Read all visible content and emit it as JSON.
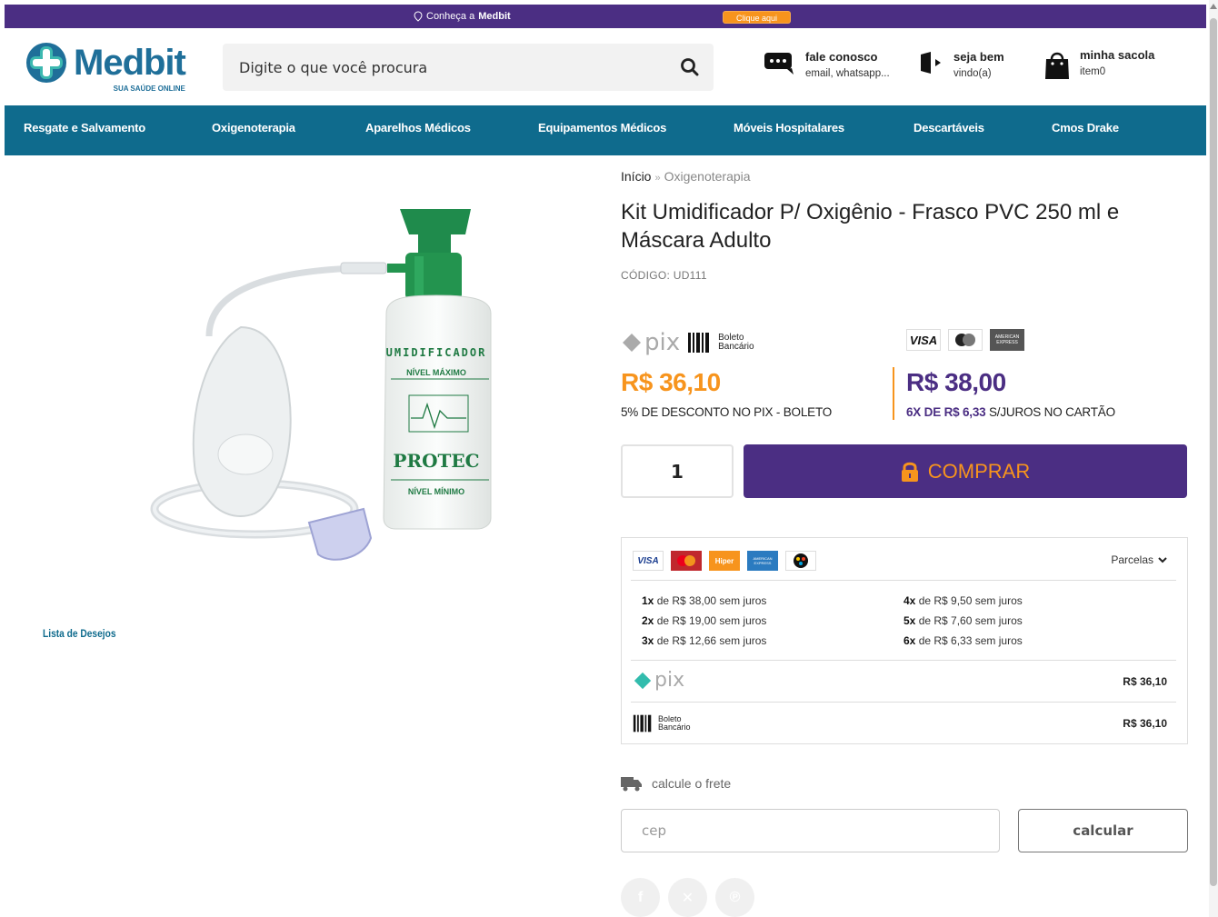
{
  "topbar": {
    "announce_prefix": "Conheça a",
    "announce_brand": "Medbit",
    "cta": "Clique aqui"
  },
  "header": {
    "logo_name": "Medbit",
    "logo_tagline": "SUA SAÚDE ONLINE",
    "search_placeholder": "Digite o que você procura",
    "contact": {
      "title": "fale conosco",
      "subtitle": "email, whatsapp..."
    },
    "account": {
      "title": "seja bem",
      "subtitle": "vindo(a)"
    },
    "bag": {
      "title": "minha sacola",
      "subtitle": "item0"
    }
  },
  "nav": [
    "Resgate e Salvamento",
    "Oxigenoterapia",
    "Aparelhos Médicos",
    "Equipamentos Médicos",
    "Móveis Hospitalares",
    "Descartáveis",
    "Cmos Drake"
  ],
  "product": {
    "image_bottle_text": [
      "UMIDIFICADOR",
      "NÍVEL MÁXIMO",
      "PROTEC",
      "NÍVEL MÍNIMO"
    ],
    "wishlist": "Lista de Desejos",
    "breadcrumb": {
      "home": "Início",
      "sep": "»",
      "current": "Oxigenoterapia"
    },
    "title": "Kit Umidificador P/ Oxigênio - Frasco PVC 250 ml e Máscara Adulto",
    "code": "CÓDIGO: UD111",
    "pix_label": "pix",
    "boleto_label_1": "Boleto",
    "boleto_label_2": "Bancário",
    "card_logos": [
      "VISA",
      "AMERICAN EXPRESS"
    ],
    "price_pix": "R$ 36,10",
    "price_pix_note": "5% DE DESCONTO NO PIX - BOLETO",
    "price_card": "R$ 38,00",
    "price_card_note_bold": "6X DE R$ 6,33",
    "price_card_note_rest": " S/JUROS NO CARTÃO",
    "quantity": "1",
    "buy_label": "COMPRAR"
  },
  "installments": {
    "toggle_label": "Parcelas",
    "brands": [
      "VISA",
      "Hiper",
      "AMERICAN EXPRESS"
    ],
    "left": [
      {
        "n": "1x",
        "text": " de R$ 38,00 sem juros"
      },
      {
        "n": "2x",
        "text": " de R$ 19,00 sem juros"
      },
      {
        "n": "3x",
        "text": " de R$ 12,66 sem juros"
      }
    ],
    "right": [
      {
        "n": "4x",
        "text": " de R$ 9,50 sem juros"
      },
      {
        "n": "5x",
        "text": " de R$ 7,60 sem juros"
      },
      {
        "n": "6x",
        "text": " de R$ 6,33 sem juros"
      }
    ],
    "pix_value": "R$ 36,10",
    "boleto_value": "R$ 36,10"
  },
  "shipping": {
    "label": "calcule o frete",
    "cep_placeholder": "cep",
    "button": "calcular"
  },
  "colors": {
    "purple": "#4b2e83",
    "orange": "#f7941d",
    "teal": "#0f6b8d",
    "pix": "#32bcad"
  }
}
